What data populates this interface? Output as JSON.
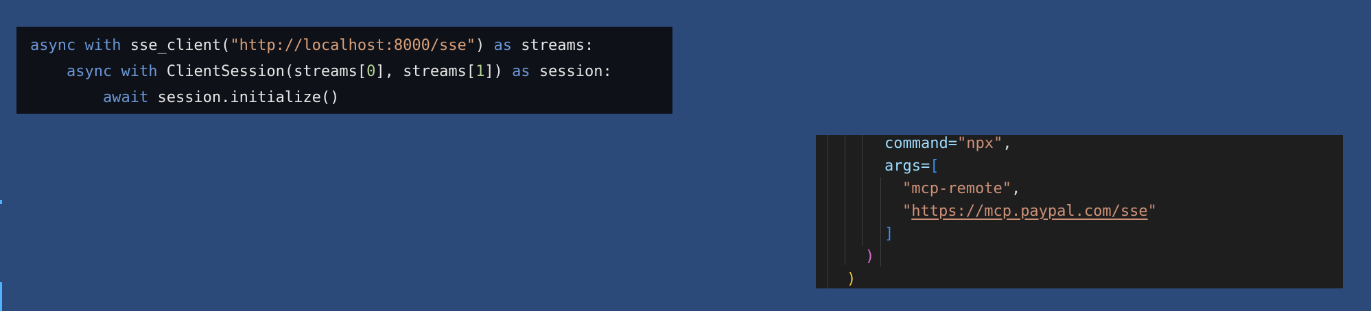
{
  "left_snippet": {
    "line1": {
      "kw1": "async",
      "kw2": "with",
      "call": "sse_client(",
      "url": "\"http://localhost:8000/sse\"",
      "close": ")",
      "kw3": "as",
      "rest": "streams:"
    },
    "line2": {
      "kw1": "async",
      "kw2": "with",
      "call": "ClientSession(streams[",
      "idx0": "0",
      "mid": "], streams[",
      "idx1": "1",
      "close": "])",
      "kw3": "as",
      "rest": "session:"
    },
    "line3": {
      "kw1": "await",
      "rest": "session.initialize()"
    }
  },
  "right_snippet": {
    "command_key": "command=",
    "command_value": "\"npx\"",
    "command_comma": ",",
    "args_key": "args=",
    "args_open": "[",
    "arg1": "\"mcp-remote\"",
    "arg1_comma": ",",
    "arg2_quote": "\"",
    "arg2_url": "https://mcp.paypal.com/sse",
    "arg2_close_quote": "\"",
    "args_close": "]",
    "paren_close": ")",
    "outer_close": ")"
  },
  "colors": {
    "background": "#2b4a79",
    "left_panel": "#0f1118",
    "right_panel": "#1e1e1e",
    "keyword": "#6a97d6",
    "string": "#d8a07a",
    "number": "#b9d49a",
    "identifier": "#9cdcfe"
  }
}
